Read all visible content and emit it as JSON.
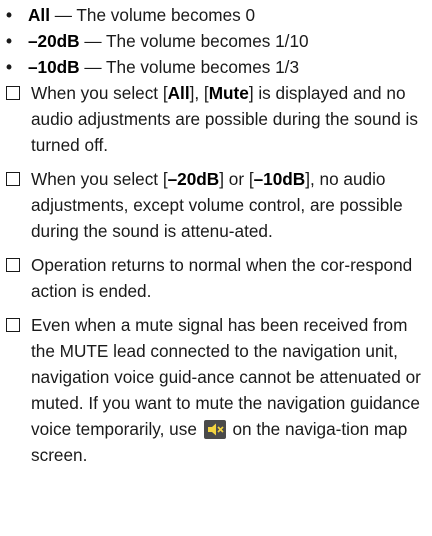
{
  "options": [
    {
      "term": "All",
      "sep": " — ",
      "desc": "The volume becomes 0"
    },
    {
      "term": "–20dB",
      "sep": " — ",
      "desc": "The volume becomes 1/10"
    },
    {
      "term": "–10dB",
      "sep": " — ",
      "desc": "The volume becomes 1/3"
    }
  ],
  "notes": {
    "n1": {
      "t1": "When you select [",
      "b1": "All",
      "t2": "], [",
      "b2": "Mute",
      "t3": "] is displayed and no audio adjustments are possible during the sound is turned off."
    },
    "n2": {
      "t1": "When you select [",
      "b1": "–20dB",
      "t2": "] or [",
      "b2": "–10dB",
      "t3": "], no audio adjustments, except volume control, are possible during the sound is attenu-ated."
    },
    "n3": {
      "t1": "Operation returns to normal when the cor-respond action is ended."
    },
    "n4": {
      "t1": "Even when a mute signal has been received from the MUTE lead connected to the navigation unit, navigation voice guid-ance cannot be attenuated or muted. If you want to mute the navigation guidance voice temporarily, use",
      "icon": "speaker-mute-icon",
      "t2": "on the naviga-tion map screen."
    }
  },
  "colors": {
    "text": "#1a1a1a",
    "icon_bg": "#4a4a4a",
    "icon_fg": "#f2d340"
  }
}
